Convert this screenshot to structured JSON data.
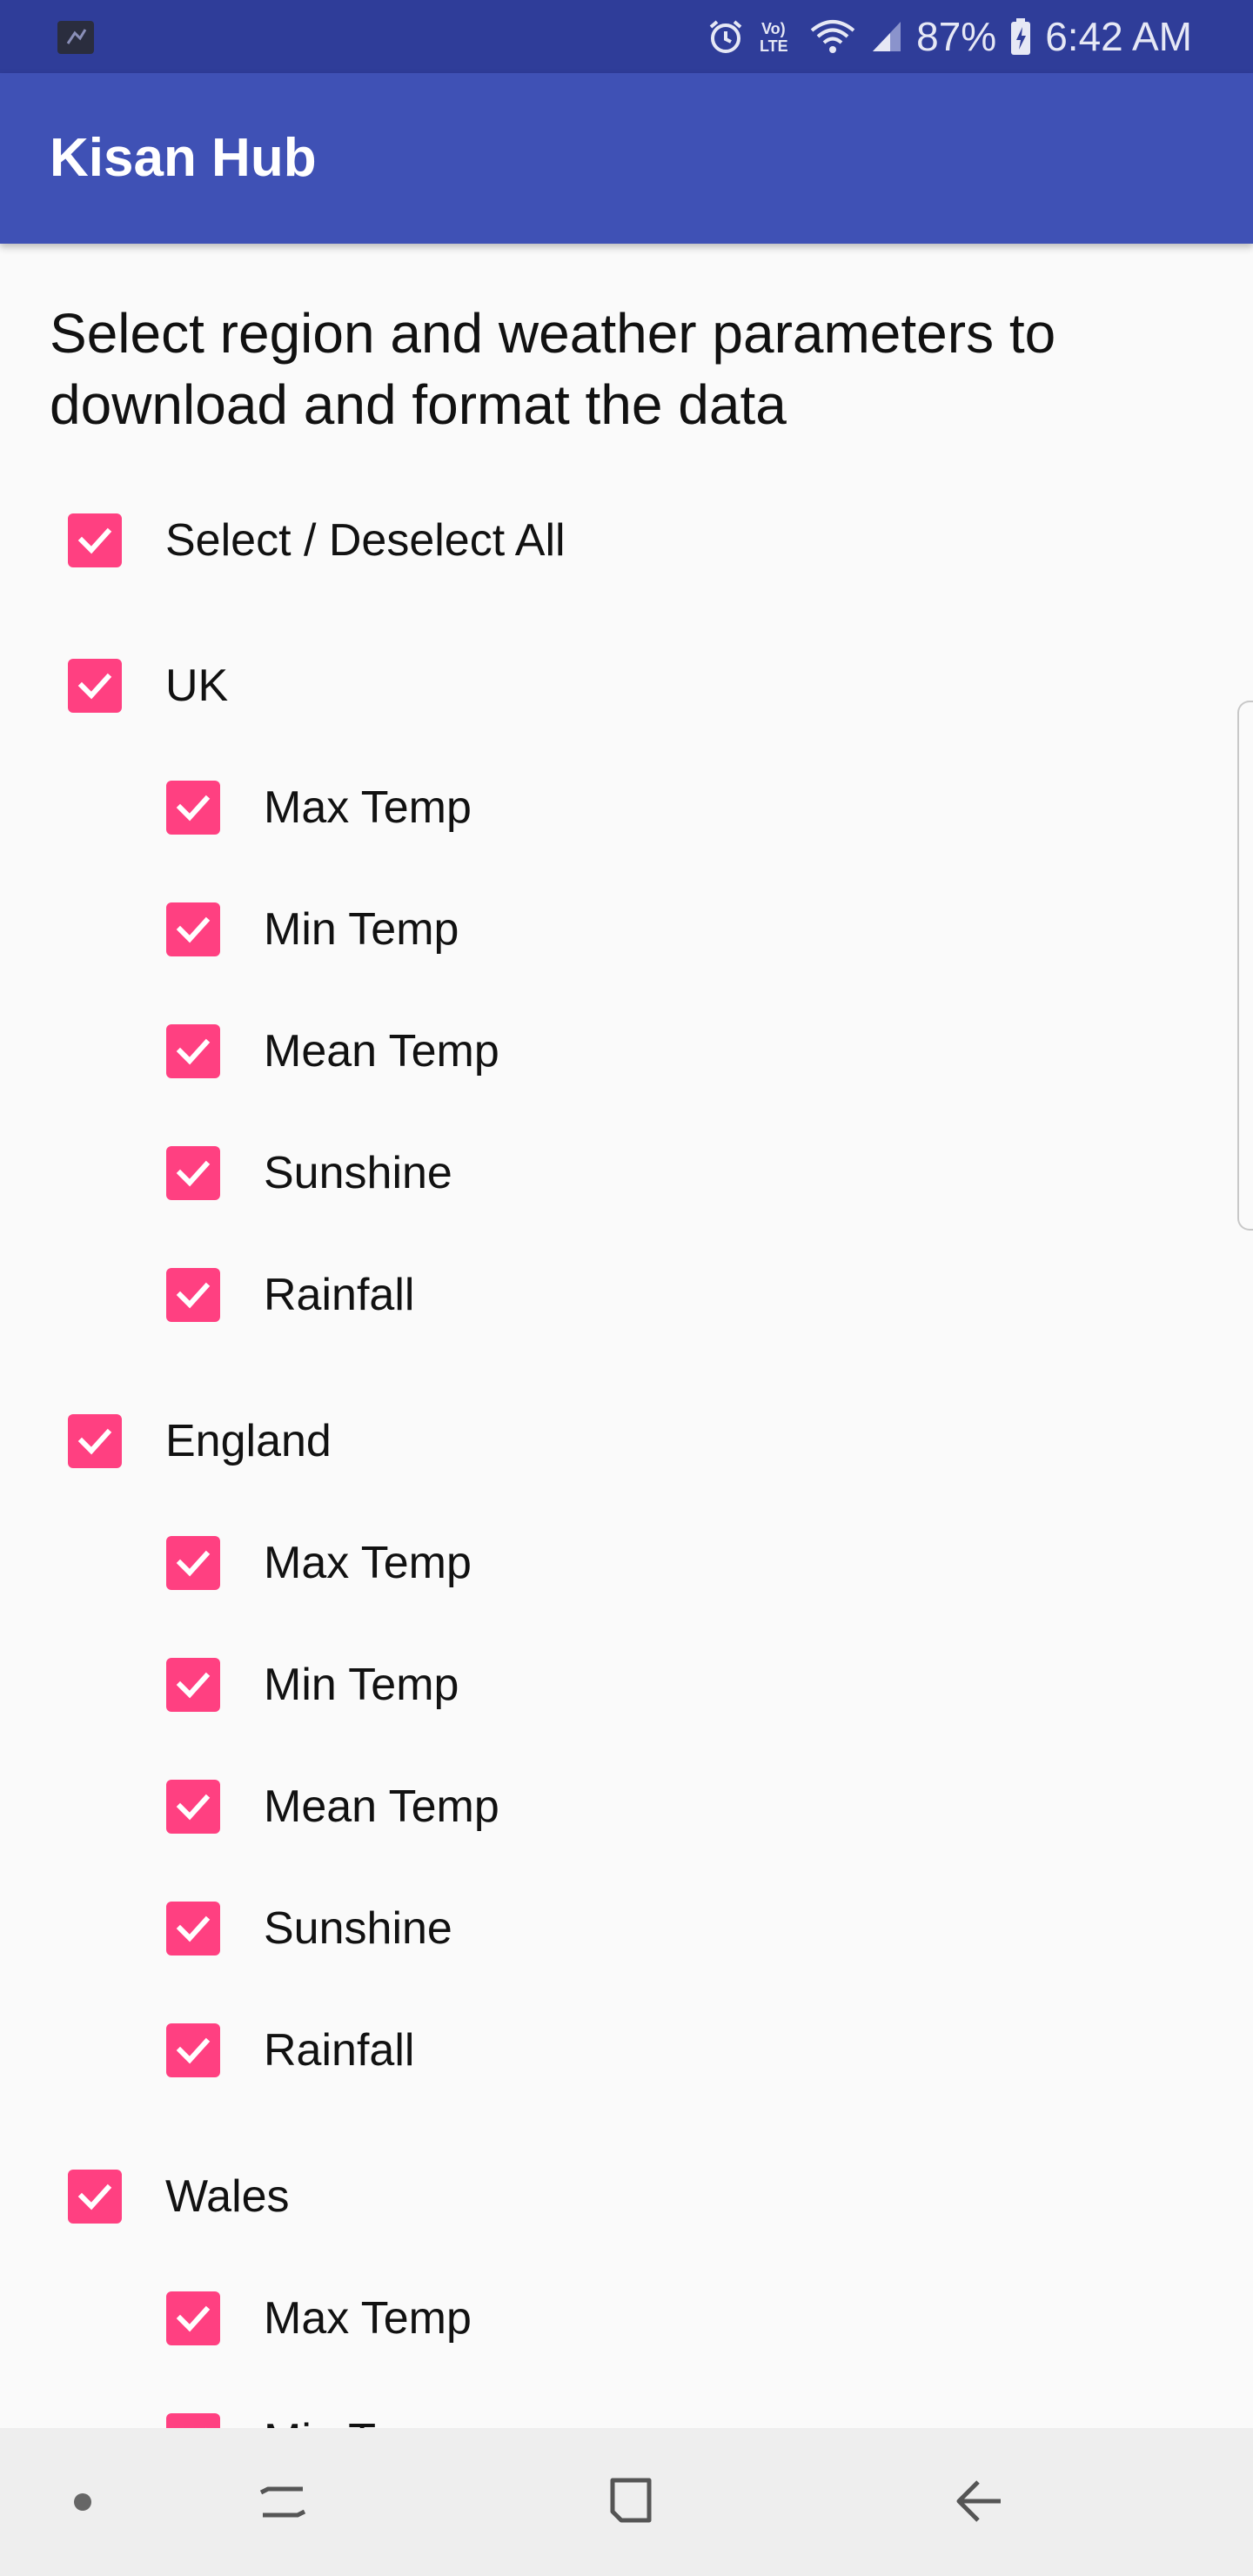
{
  "status_bar": {
    "battery": "87%",
    "time": "6:42 AM",
    "icons": [
      "notification-app-icon",
      "alarm-icon",
      "volte-icon",
      "wifi-icon",
      "signal-icon",
      "battery-charging-icon"
    ]
  },
  "app_bar": {
    "title": "Kisan Hub"
  },
  "instruction": "Select region and weather parameters to download and format the data",
  "select_all": {
    "label": "Select / Deselect All",
    "checked": true
  },
  "regions": [
    {
      "name": "UK",
      "checked": true,
      "params": [
        {
          "label": "Max Temp",
          "checked": true
        },
        {
          "label": "Min Temp",
          "checked": true
        },
        {
          "label": "Mean Temp",
          "checked": true
        },
        {
          "label": "Sunshine",
          "checked": true
        },
        {
          "label": "Rainfall",
          "checked": true
        }
      ]
    },
    {
      "name": "England",
      "checked": true,
      "params": [
        {
          "label": "Max Temp",
          "checked": true
        },
        {
          "label": "Min Temp",
          "checked": true
        },
        {
          "label": "Mean Temp",
          "checked": true
        },
        {
          "label": "Sunshine",
          "checked": true
        },
        {
          "label": "Rainfall",
          "checked": true
        }
      ]
    },
    {
      "name": "Wales",
      "checked": true,
      "params": [
        {
          "label": "Max Temp",
          "checked": true
        },
        {
          "label": "Min Temp",
          "checked": true
        }
      ]
    }
  ],
  "colors": {
    "primary": "#3f51b5",
    "primary_dark": "#2f3d99",
    "accent": "#ff4081"
  },
  "nav_bar": {
    "icons": [
      "dot-icon",
      "recents-icon",
      "home-icon",
      "back-icon"
    ]
  }
}
